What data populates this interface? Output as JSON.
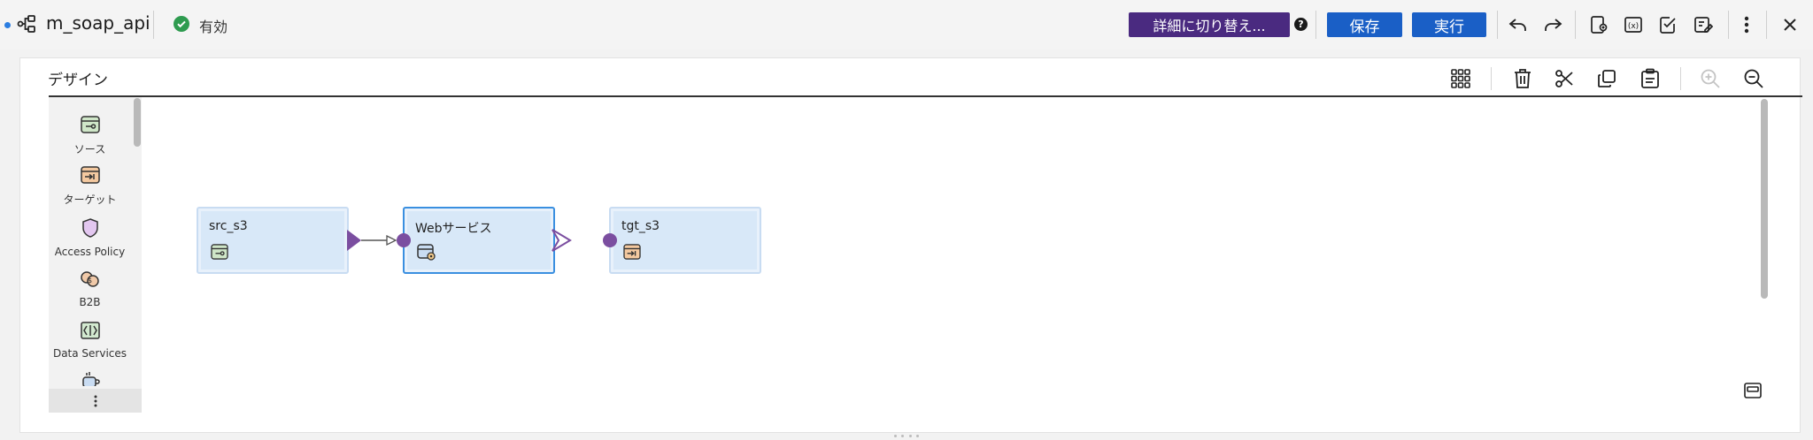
{
  "header": {
    "title": "m_soap_api",
    "status": "有効",
    "detail_button": "詳細に切り替え...",
    "help": "?",
    "save_button": "保存",
    "run_button": "実行"
  },
  "design": {
    "title": "デザイン"
  },
  "palette": {
    "items": [
      {
        "label": "ソース",
        "icon": "source-icon"
      },
      {
        "label": "ターゲット",
        "icon": "target-icon"
      },
      {
        "label": "Access Policy",
        "icon": "shield-icon"
      },
      {
        "label": "B2B",
        "icon": "b2b-icon"
      },
      {
        "label": "Data Services",
        "icon": "data-services-icon"
      },
      {
        "label": "",
        "icon": "cup-icon"
      }
    ],
    "more": "⋮"
  },
  "nodes": [
    {
      "label": "src_s3",
      "icon": "source-icon"
    },
    {
      "label": "Webサービス",
      "icon": "web-service-icon"
    },
    {
      "label": "tgt_s3",
      "icon": "target-icon"
    }
  ],
  "colors": {
    "accent_purple": "#4a2a80",
    "primary_blue": "#1a5fc6",
    "node_fill": "#d8e8f8",
    "port_purple": "#7b4ea0",
    "status_green": "#2e9b4f"
  }
}
